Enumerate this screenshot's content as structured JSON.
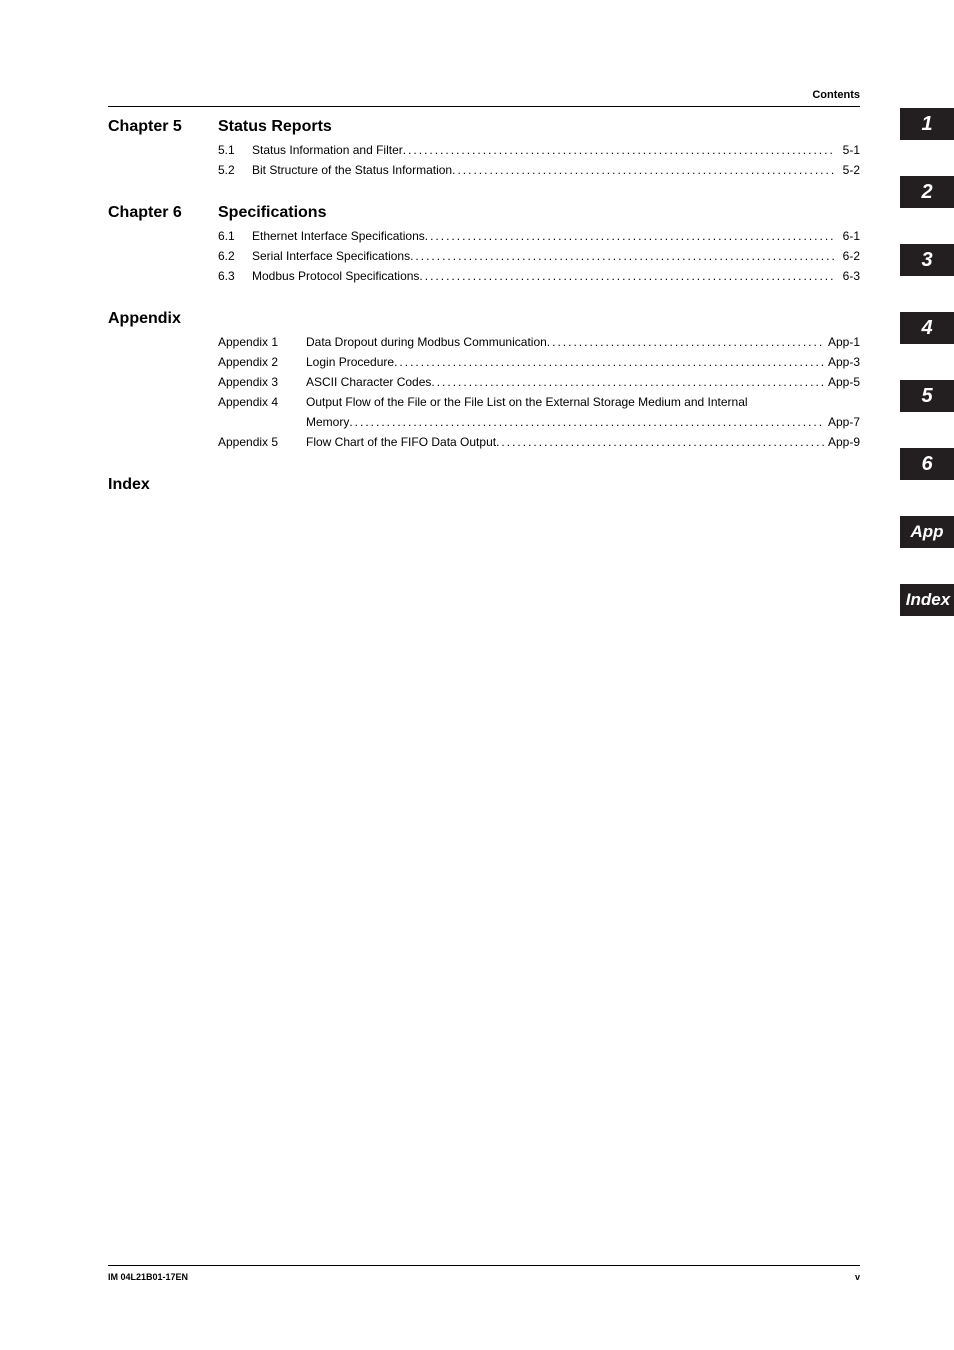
{
  "header": {
    "label": "Contents"
  },
  "toc": [
    {
      "label": "Chapter 5",
      "title": "Status Reports",
      "items": [
        {
          "num": "5.1",
          "title": "Status Information and Filter",
          "page": "5-1"
        },
        {
          "num": "5.2",
          "title": "Bit Structure of the Status Information",
          "page": "5-2"
        }
      ]
    },
    {
      "label": "Chapter 6",
      "title": "Specifications",
      "items": [
        {
          "num": "6.1",
          "title": "Ethernet Interface Specifications",
          "page": "6-1"
        },
        {
          "num": "6.2",
          "title": "Serial Interface Specifications",
          "page": "6-2"
        },
        {
          "num": "6.3",
          "title": "Modbus Protocol Specifications",
          "page": "6-3"
        }
      ]
    }
  ],
  "appendix": {
    "label": "Appendix",
    "items": [
      {
        "num": "Appendix 1",
        "title": "Data Dropout during Modbus Communication",
        "page": "App-1"
      },
      {
        "num": "Appendix 2",
        "title": "Login Procedure",
        "page": "App-3"
      },
      {
        "num": "Appendix 3",
        "title": "ASCII Character Codes",
        "page": "App-5"
      },
      {
        "num": "Appendix 4",
        "title_line1": "Output Flow of the File or the File List on the External Storage Medium and Internal",
        "title_line2": "Memory",
        "page": "App-7"
      },
      {
        "num": "Appendix 5",
        "title": "Flow Chart of the FIFO Data Output",
        "page": "App-9"
      }
    ]
  },
  "index_label": "Index",
  "footer": {
    "doc": "IM 04L21B01-17EN",
    "page": "v"
  },
  "tabs": [
    "1",
    "2",
    "3",
    "4",
    "5",
    "6",
    "App",
    "Index"
  ],
  "dots": "...................................................................................................................................................................................."
}
